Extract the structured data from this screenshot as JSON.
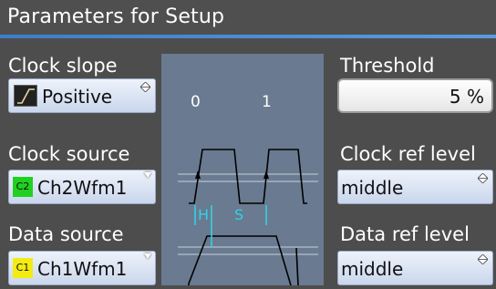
{
  "window": {
    "title": "Parameters for Setup"
  },
  "clock_slope": {
    "label": "Clock slope",
    "value": "Positive"
  },
  "clock_source": {
    "label": "Clock source",
    "value": "Ch2Wfm1",
    "tag": "C2",
    "tag_color": "#22d022"
  },
  "data_source": {
    "label": "Data source",
    "value": "Ch1Wfm1",
    "tag": "C1",
    "tag_color": "#f2ec12"
  },
  "threshold": {
    "label": "Threshold",
    "value": "5 %"
  },
  "clock_ref_level": {
    "label": "Clock ref level",
    "value": "middle"
  },
  "data_ref_level": {
    "label": "Data ref level",
    "value": "middle"
  },
  "diagram": {
    "bit0": "0",
    "bit1": "1",
    "hold": "H",
    "setup": "S"
  },
  "colors": {
    "panel_bg": "#4d4d4d",
    "diagram_bg": "#6a7a90",
    "cyan": "#2fd3e6",
    "accent": "#3a7fc8"
  }
}
